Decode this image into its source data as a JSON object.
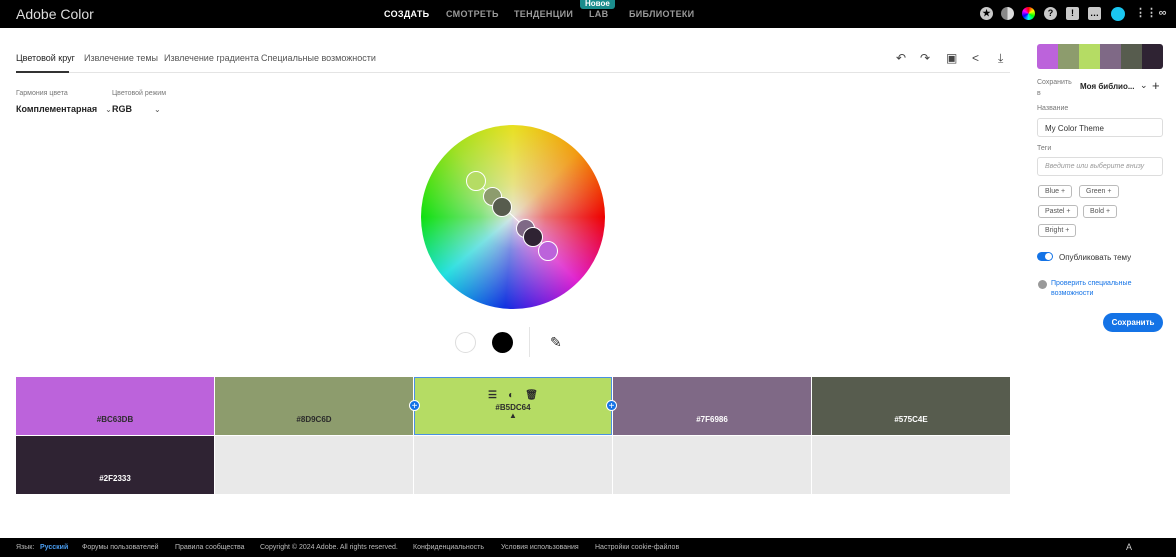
{
  "header": {
    "logo": "Adobe Color",
    "nav": [
      "СОЗДАТЬ",
      "СМОТРЕТЬ",
      "ТЕНДЕНЦИИ",
      "LAB",
      "БИБЛИОТЕКИ"
    ],
    "new_badge": "Новое"
  },
  "tabs": [
    "Цветовой круг",
    "Извлечение темы",
    "Извлечение градиента",
    "Специальные возможности"
  ],
  "controls": {
    "harmony_label": "Гармония цвета",
    "harmony_value": "Комплементарная",
    "mode_label": "Цветовой режим",
    "mode_value": "RGB"
  },
  "swatches": [
    {
      "hex": "#BC63DB",
      "label": "#BC63DB"
    },
    {
      "hex": "#8D9C6D",
      "label": "#8D9C6D"
    },
    {
      "hex": "#B5DC64",
      "label": "#B5DC64"
    },
    {
      "hex": "#7F6986",
      "label": "#7F6986"
    },
    {
      "hex": "#575C4E",
      "label": "#575C4E"
    },
    {
      "hex": "#2F2333",
      "label": "#2F2333"
    }
  ],
  "panel": {
    "save_to_label": "Сохранить в",
    "library": "Моя библио...",
    "name_label": "Название",
    "name_value": "My Color Theme",
    "tags_label": "Теги",
    "tags_placeholder": "Введите или выберите внизу",
    "tags": [
      "Blue",
      "Green",
      "Pastel",
      "Bold",
      "Bright"
    ],
    "publish": "Опубликовать тему",
    "a11y_link": "Проверить специальные возможности",
    "save_button": "Сохранить"
  },
  "footer": {
    "lang_label": "Язык:",
    "lang": "Русский",
    "links": [
      "Форумы пользователей",
      "Правила сообщества",
      "Copyright © 2024 Adobe. All rights reserved.",
      "Конфиденциальность",
      "Условия использования",
      "Настройки cookie-файлов"
    ]
  },
  "colors": {
    "accent": "#1473e6"
  }
}
